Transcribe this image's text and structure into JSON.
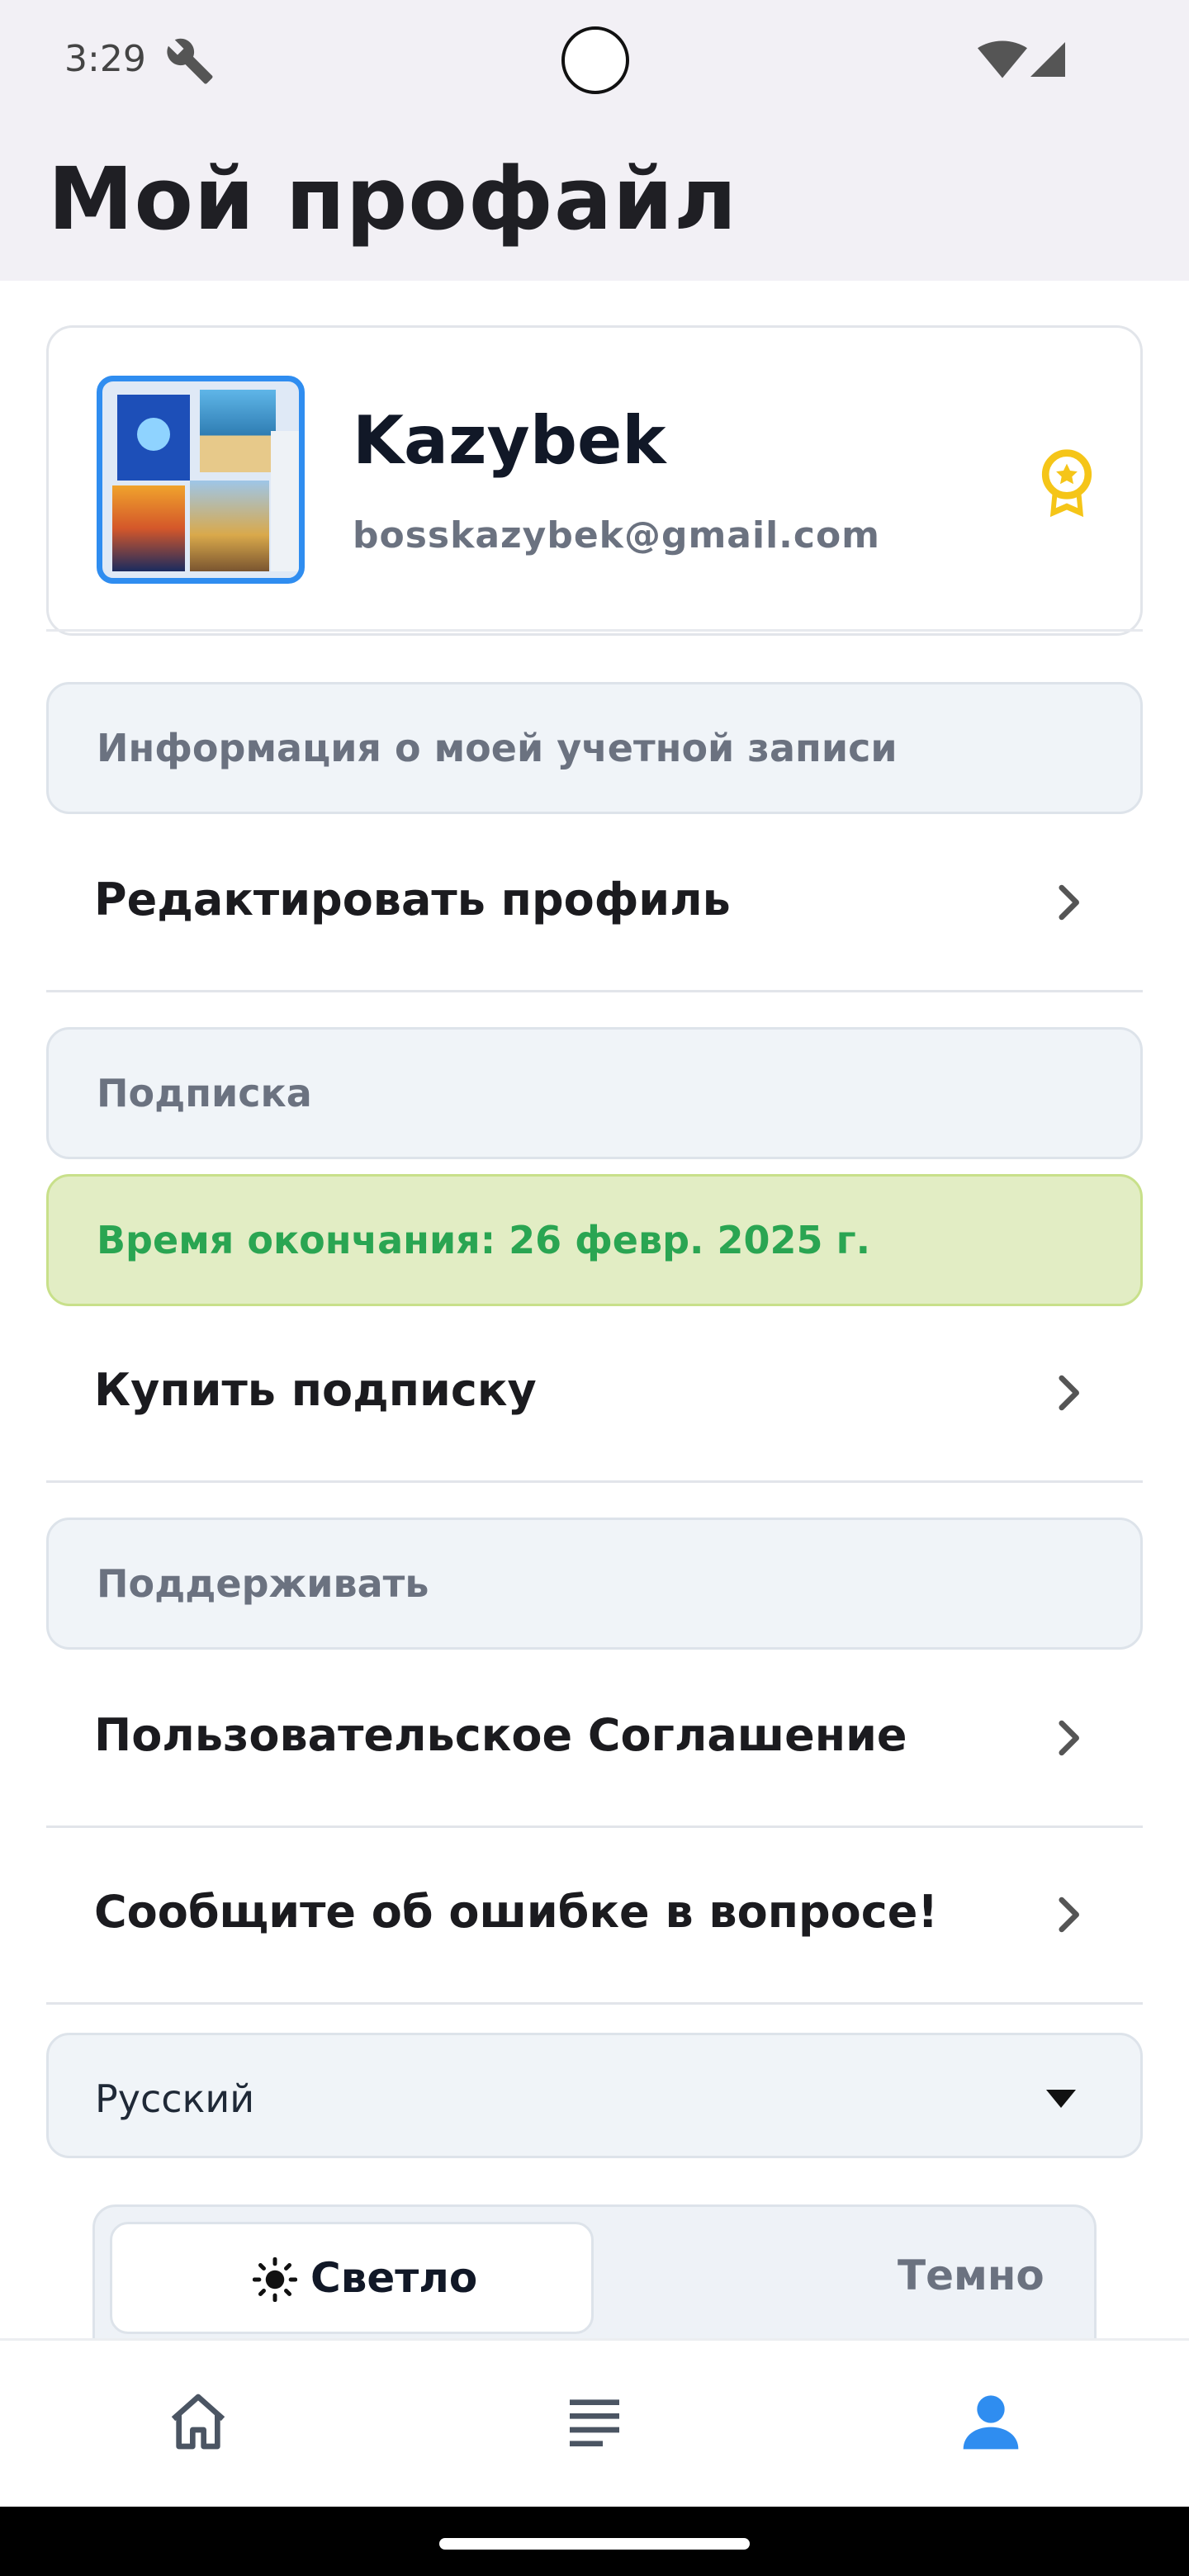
{
  "status_bar": {
    "time": "3:29"
  },
  "header": {
    "title": "Мой профайл"
  },
  "profile": {
    "name": "Kazybek",
    "email": "bosskazybek@gmail.com"
  },
  "sections": {
    "account": "Информация о моей учетной записи",
    "subscription": "Подписка",
    "support": "Поддерживать"
  },
  "rows": {
    "edit_profile": "Редактировать профиль",
    "buy_subscription": "Купить подписку",
    "user_agreement": "Пользовательское Соглашение",
    "report_error": "Сообщите об ошибке в вопросе!"
  },
  "subscription": {
    "expiry": "Время окончания: 26 февр. 2025 г."
  },
  "language": {
    "selected": "Русский"
  },
  "theme": {
    "light_label": "Светло",
    "dark_label": "Темно",
    "active": "light"
  },
  "colors": {
    "accent": "#2f8df0",
    "success": "#2aa552",
    "badge": "#f5c518"
  }
}
